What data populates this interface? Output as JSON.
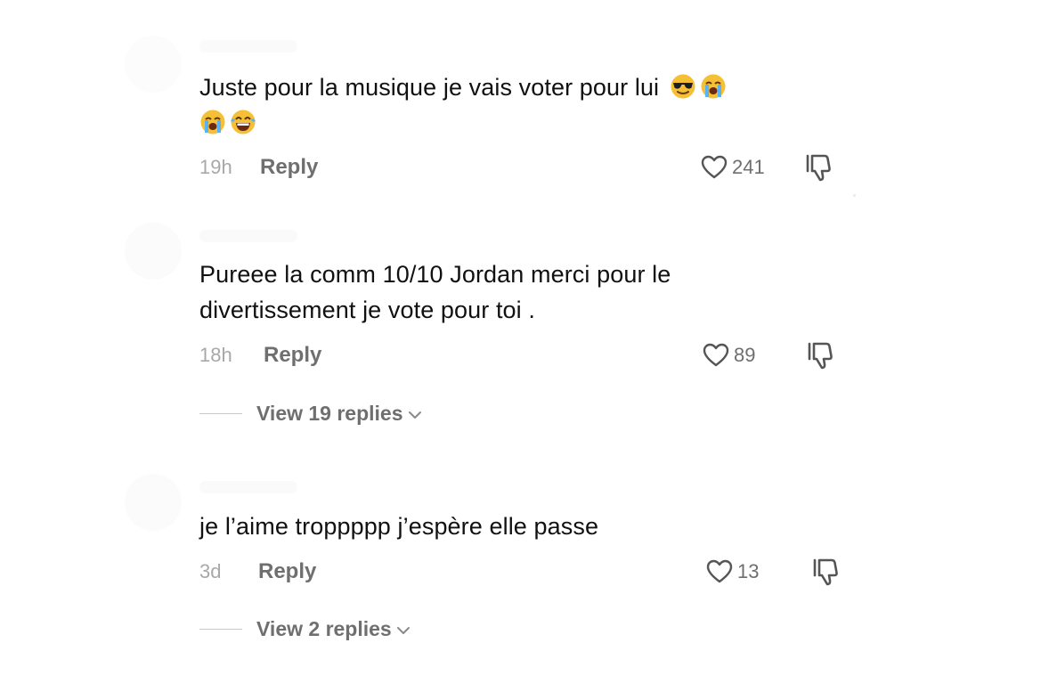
{
  "comments": [
    {
      "text": "Juste pour la musique je vais voter pour lui",
      "emojis": [
        "smiling-face-with-sunglasses",
        "loudly-crying-face",
        "loudly-crying-face",
        "face-with-tears-of-joy"
      ],
      "time": "19h",
      "reply_label": "Reply",
      "likes": "241"
    },
    {
      "text_line1": "Pureee la comm 10/10 Jordan merci pour le",
      "text_line2": "divertissement je vote pour toi .",
      "time": "18h",
      "reply_label": "Reply",
      "likes": "89",
      "view_replies": "View 19 replies"
    },
    {
      "text": "je l’aime troppppp j’espère elle passe",
      "time": "3d",
      "reply_label": "Reply",
      "likes": "13",
      "view_replies": "View 2 replies"
    }
  ],
  "colors": {
    "text": "#111111",
    "muted": "#6f6f6f",
    "time": "#a8a8a8",
    "icon": "#555555"
  },
  "icons": {
    "like": "heart-outline-icon",
    "dislike": "thumbs-down-icon",
    "expand": "chevron-down-icon"
  }
}
